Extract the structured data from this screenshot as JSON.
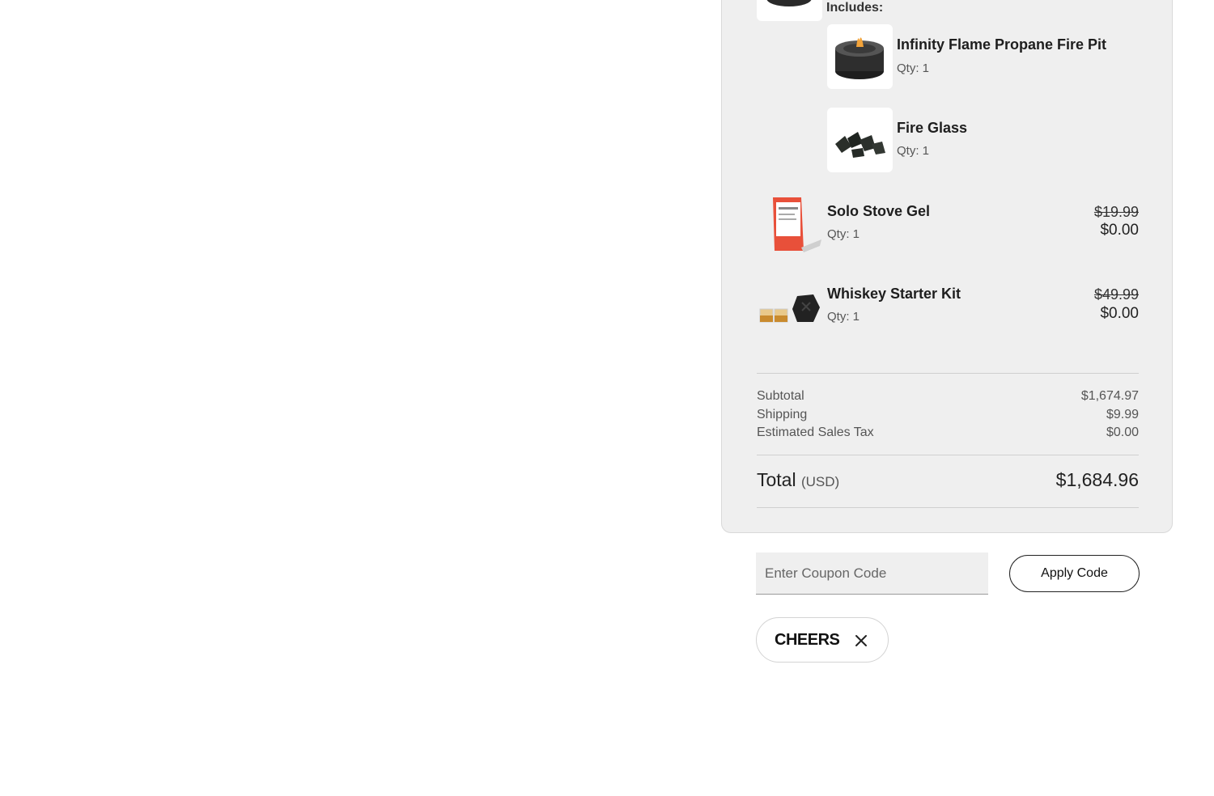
{
  "cart": {
    "includes_label": "Includes:",
    "included_items": [
      {
        "name": "Infinity Flame Propane Fire Pit",
        "qty": "Qty: 1",
        "icon": "fire-pit-thumbnail"
      },
      {
        "name": "Fire Glass",
        "qty": "Qty: 1",
        "icon": "fire-glass-thumbnail"
      }
    ],
    "items": [
      {
        "name": "Solo Stove Gel",
        "qty": "Qty: 1",
        "original_price": "$19.99",
        "price": "$0.00",
        "icon": "gel-pack-thumbnail"
      },
      {
        "name": "Whiskey Starter Kit",
        "qty": "Qty: 1",
        "original_price": "$49.99",
        "price": "$0.00",
        "icon": "whiskey-kit-thumbnail"
      }
    ]
  },
  "summary": {
    "subtotal_label": "Subtotal",
    "subtotal_value": "$1,674.97",
    "shipping_label": "Shipping",
    "shipping_value": "$9.99",
    "tax_label": "Estimated Sales Tax",
    "tax_value": "$0.00",
    "total_label": "Total",
    "total_currency": "(USD)",
    "total_value": "$1,684.96"
  },
  "coupon": {
    "placeholder": "Enter Coupon Code",
    "apply_label": "Apply Code",
    "applied_code": "CHEERS"
  },
  "colors": {
    "panel_bg": "#efefef",
    "page_bg": "#ffffff",
    "text": "#222222"
  }
}
